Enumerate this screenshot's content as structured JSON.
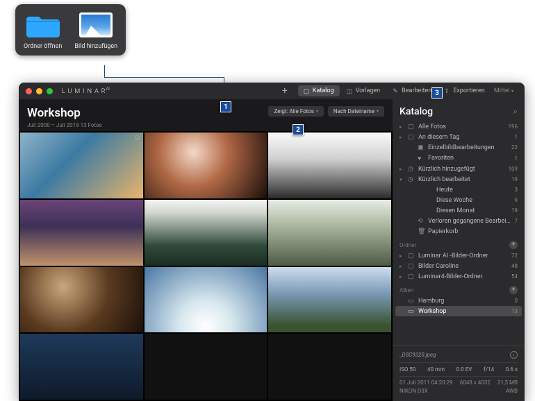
{
  "callout": {
    "open_folder": "Ordner öffnen",
    "add_image": "Bild hinzufügen"
  },
  "brand": "LUMINAR",
  "brand_sup": "AI",
  "tabs": {
    "katalog": "Katalog",
    "vorlagen": "Vorlagen",
    "bearbeiten": "Bearbeiten",
    "exportieren": "Exportieren"
  },
  "zoom_label": "Mittel",
  "workspace": {
    "title": "Workshop",
    "subtitle": "Juli 2000 – Juli 2019   13 Fotos"
  },
  "filters": {
    "show": "Zeigt: Alle Fotos",
    "sort": "Nach Dateiname"
  },
  "sidebar": {
    "title": "Katalog",
    "items": [
      {
        "arr": "▸",
        "ic": "▢",
        "label": "Alle Fotos",
        "count": "196"
      },
      {
        "arr": "▸",
        "ic": "▢",
        "label": "An diesem Tag",
        "count": "1"
      },
      {
        "arr": "",
        "ic": "▣",
        "label": "Einzelbildbearbeitungen",
        "count": "22",
        "indent": 1
      },
      {
        "arr": "",
        "ic": "♥",
        "label": "Favoriten",
        "count": "1",
        "indent": 1
      },
      {
        "arr": "▸",
        "ic": "◷",
        "label": "Kürzlich hinzugefügt",
        "count": "109"
      },
      {
        "arr": "▾",
        "ic": "◷",
        "label": "Kürzlich bearbeitet",
        "count": "19"
      },
      {
        "arr": "",
        "ic": "",
        "label": "Heute",
        "count": "3",
        "indent": 2
      },
      {
        "arr": "",
        "ic": "",
        "label": "Diese Woche",
        "count": "9",
        "indent": 2
      },
      {
        "arr": "",
        "ic": "",
        "label": "Diesen Monat",
        "count": "19",
        "indent": 2
      },
      {
        "arr": "",
        "ic": "⟲",
        "label": "Verloren gegangene Bearbeitungen",
        "count": "7",
        "indent": 1
      },
      {
        "arr": "",
        "ic": "🗑",
        "label": "Papierkorb",
        "count": "",
        "indent": 1
      }
    ],
    "folders_head": "Ordner",
    "folders": [
      {
        "arr": "▸",
        "ic": "▢",
        "label": "Luminar AI -Bilder-Ordner",
        "count": "72"
      },
      {
        "arr": "▸",
        "ic": "▢",
        "label": "Bilder Caroline",
        "count": "48"
      },
      {
        "arr": "▸",
        "ic": "▢",
        "label": "Luminar4-Bilder-Ordner",
        "count": "54"
      }
    ],
    "albums_head": "Alben",
    "albums": [
      {
        "arr": "",
        "ic": "▭",
        "label": "Hamburg",
        "count": "0"
      },
      {
        "arr": "",
        "ic": "▭",
        "label": "Workshop",
        "count": "13",
        "selected": true
      }
    ]
  },
  "meta": {
    "filename": "_DSC9320.jpeg",
    "iso": "ISO 50",
    "focal": "40 mm",
    "ev": "0.0 EV",
    "aperture": "f/14",
    "shutter": "0.6 s",
    "date": "01 Juli 2011 04:20:29",
    "dims": "6048 x 4032",
    "size": "21,5 MB",
    "camera": "NIKON D3X",
    "wb": "AWB"
  },
  "markers": {
    "m1": "1",
    "m2": "2",
    "m3": "3"
  }
}
